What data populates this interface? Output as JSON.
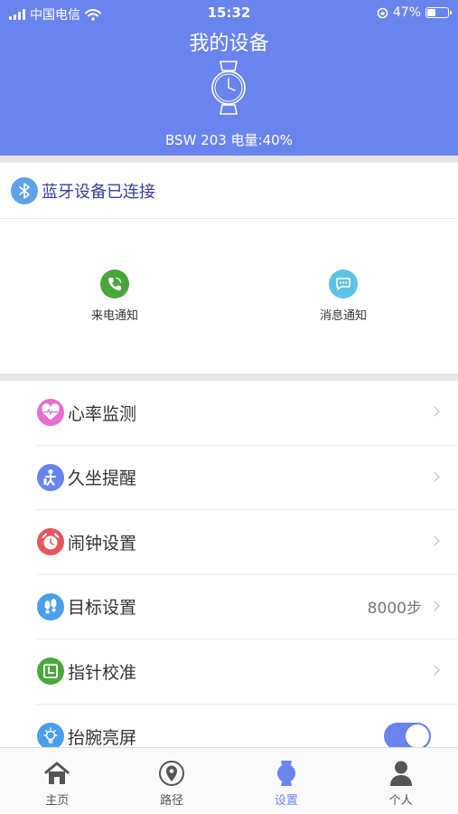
{
  "status_bar": {
    "carrier": "中国电信",
    "time": "15:32",
    "battery_percent": "47%",
    "battery_level": 0.47,
    "icons": [
      "signal-icon",
      "wifi-icon",
      "orientation-lock-icon",
      "battery-icon"
    ]
  },
  "header": {
    "title": "我的设备",
    "device_info": "BSW 203 电量:40%",
    "device_icon": "watch-icon",
    "background": "#6a84ee"
  },
  "bluetooth": {
    "status": "蓝牙设备已连接",
    "icon": "bluetooth-icon"
  },
  "quick_actions": [
    {
      "label": "来电通知",
      "icon": "phone-icon",
      "color": "#4aa63c"
    },
    {
      "label": "消息通知",
      "icon": "message-icon",
      "color": "#5ec2e4"
    }
  ],
  "settings": [
    {
      "label": "心率监测",
      "icon": "heart-rate-icon",
      "color": "#e66fd0",
      "value": ""
    },
    {
      "label": "久坐提醒",
      "icon": "sedentary-icon",
      "color": "#6a84ee",
      "value": ""
    },
    {
      "label": "闹钟设置",
      "icon": "alarm-clock-icon",
      "color": "#e5555c",
      "value": ""
    },
    {
      "label": "目标设置",
      "icon": "footprint-icon",
      "color": "#4a9eea",
      "value": "8000步"
    },
    {
      "label": "指针校准",
      "icon": "calibrate-icon",
      "color": "#49a83b",
      "value": ""
    },
    {
      "label": "抬腕亮屏",
      "icon": "bulb-icon",
      "color": "#4a9eea",
      "toggle_on": true
    }
  ],
  "tabs": [
    {
      "label": "主页",
      "icon": "home-icon",
      "active": false
    },
    {
      "label": "路径",
      "icon": "location-pin-icon",
      "active": false
    },
    {
      "label": "设置",
      "icon": "watch-icon",
      "active": true
    },
    {
      "label": "个人",
      "icon": "person-icon",
      "active": false
    }
  ],
  "colors": {
    "accent": "#6a84ee",
    "title_text": "#3a3d9e"
  }
}
